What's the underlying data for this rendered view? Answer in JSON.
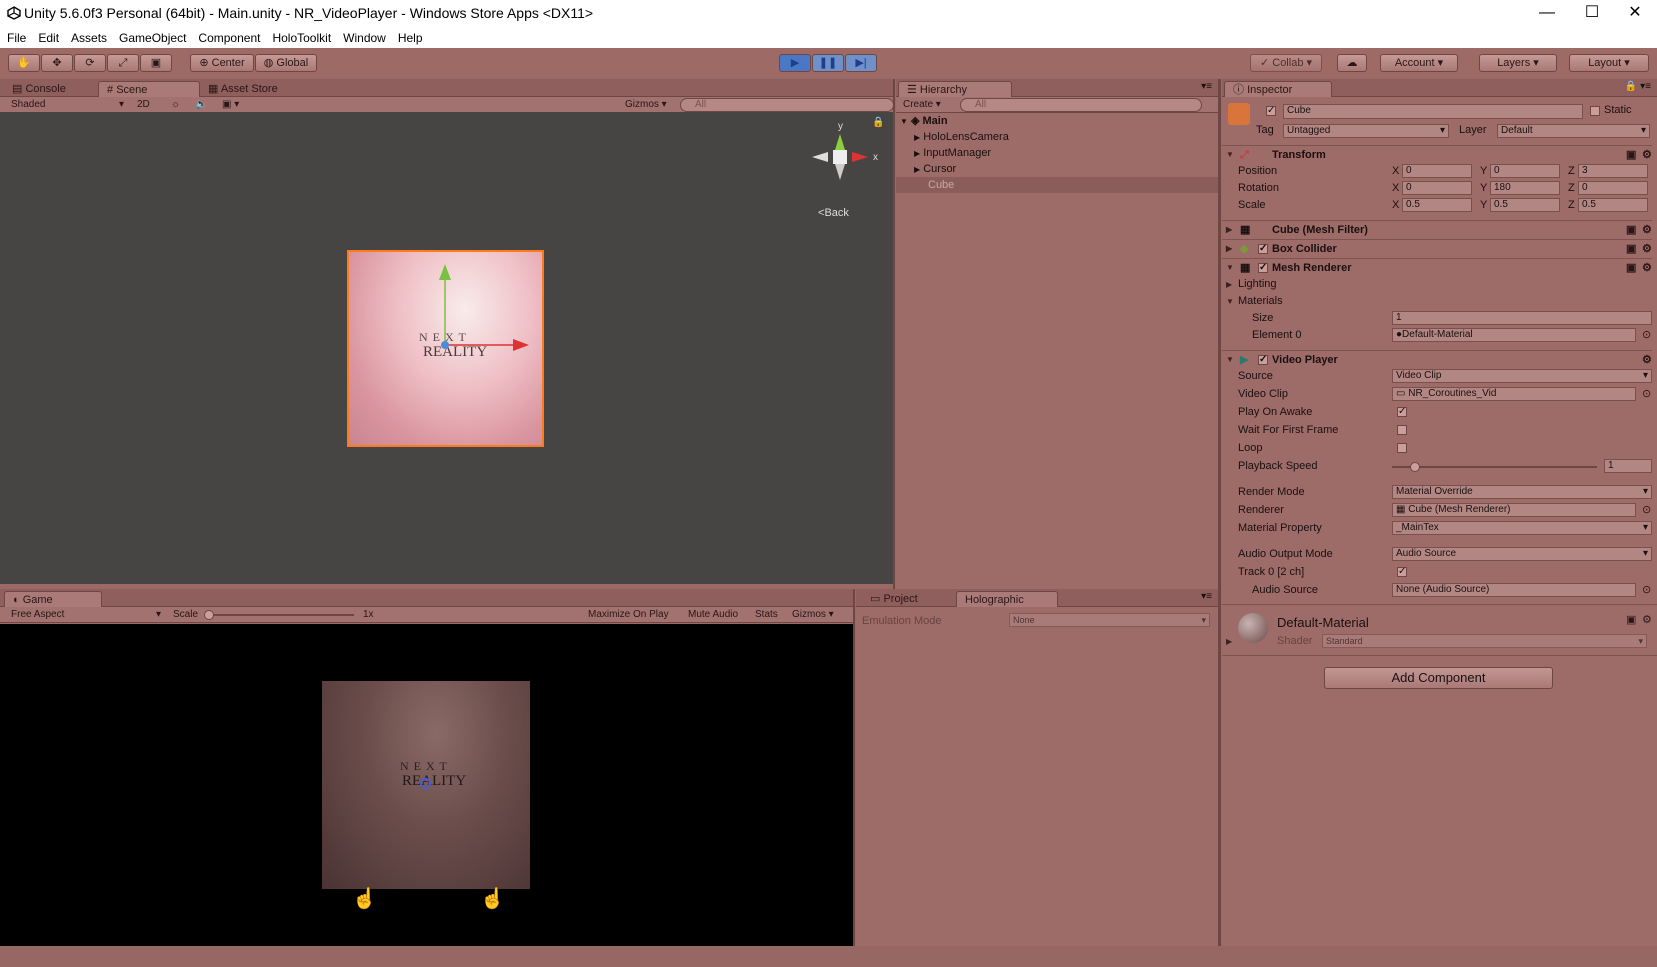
{
  "window": {
    "title": "Unity 5.6.0f3 Personal (64bit) - Main.unity - NR_VideoPlayer - Windows Store Apps <DX11>",
    "minimize": "—",
    "maximize": "☐",
    "close": "✕"
  },
  "menu": [
    "File",
    "Edit",
    "Assets",
    "GameObject",
    "Component",
    "HoloToolkit",
    "Window",
    "Help"
  ],
  "toolbar": {
    "pivot": "Center",
    "space": "Global",
    "collab": "Collab",
    "account": "Account",
    "layers": "Layers",
    "layout": "Layout",
    "tools": [
      "hand-icon",
      "move-icon",
      "rotate-icon",
      "scale-icon",
      "rect-icon"
    ]
  },
  "scene": {
    "tabs": [
      "Console",
      "Scene",
      "Asset Store"
    ],
    "shading": "Shaded",
    "mode2d": "2D",
    "gizmos": "Gizmos",
    "search": "All",
    "gizmo_back": "Back",
    "gizmo_y": "y",
    "gizmo_x": "x",
    "logo_top": "N E X T",
    "logo_bottom": "REALITY"
  },
  "game": {
    "tab": "Game",
    "aspect": "Free Aspect",
    "scale_label": "Scale",
    "scale_value": "1x",
    "maximize": "Maximize On Play",
    "mute": "Mute Audio",
    "stats": "Stats",
    "gizmos": "Gizmos",
    "logo_top": "N E X T",
    "logo_bottom": "REALITY"
  },
  "hierarchy": {
    "tab": "Hierarchy",
    "create": "Create",
    "search": "All",
    "scene": "Main",
    "items": [
      "HoloLensCamera",
      "InputManager",
      "Cursor",
      "Cube"
    ]
  },
  "project": {
    "tabs": [
      "Project",
      "Holographic"
    ],
    "emulation_label": "Emulation Mode",
    "emulation_value": "None"
  },
  "inspector": {
    "tab": "Inspector",
    "object_name": "Cube",
    "static": "Static",
    "tag_label": "Tag",
    "tag": "Untagged",
    "layer_label": "Layer",
    "layer": "Default",
    "transform": {
      "title": "Transform",
      "position_label": "Position",
      "position": [
        "0",
        "0",
        "3"
      ],
      "rotation_label": "Rotation",
      "rotation": [
        "0",
        "180",
        "0"
      ],
      "scale_label": "Scale",
      "scale": [
        "0.5",
        "0.5",
        "0.5"
      ],
      "axes": [
        "X",
        "Y",
        "Z"
      ]
    },
    "mesh_filter": "Cube (Mesh Filter)",
    "box_collider": "Box Collider",
    "mesh_renderer": {
      "title": "Mesh Renderer",
      "lighting": "Lighting",
      "materials": "Materials",
      "size_label": "Size",
      "size": "1",
      "element_label": "Element 0",
      "element": "Default-Material"
    },
    "video_player": {
      "title": "Video Player",
      "source_label": "Source",
      "source": "Video Clip",
      "clip_label": "Video Clip",
      "clip": "NR_Coroutines_Vid",
      "play_on_awake_label": "Play On Awake",
      "play_on_awake": true,
      "wait_label": "Wait For First Frame",
      "wait": false,
      "loop_label": "Loop",
      "loop": false,
      "speed_label": "Playback Speed",
      "speed": "1",
      "render_mode_label": "Render Mode",
      "render_mode": "Material Override",
      "renderer_label": "Renderer",
      "renderer": "Cube (Mesh Renderer)",
      "material_prop_label": "Material Property",
      "material_prop": "_MainTex",
      "audio_mode_label": "Audio Output Mode",
      "audio_mode": "Audio Source",
      "track_label": "Track 0 [2 ch]",
      "track": true,
      "audio_source_label": "Audio Source",
      "audio_source": "None (Audio Source)"
    },
    "material": {
      "name": "Default-Material",
      "shader_label": "Shader",
      "shader": "Standard"
    },
    "add_component": "Add Component"
  }
}
